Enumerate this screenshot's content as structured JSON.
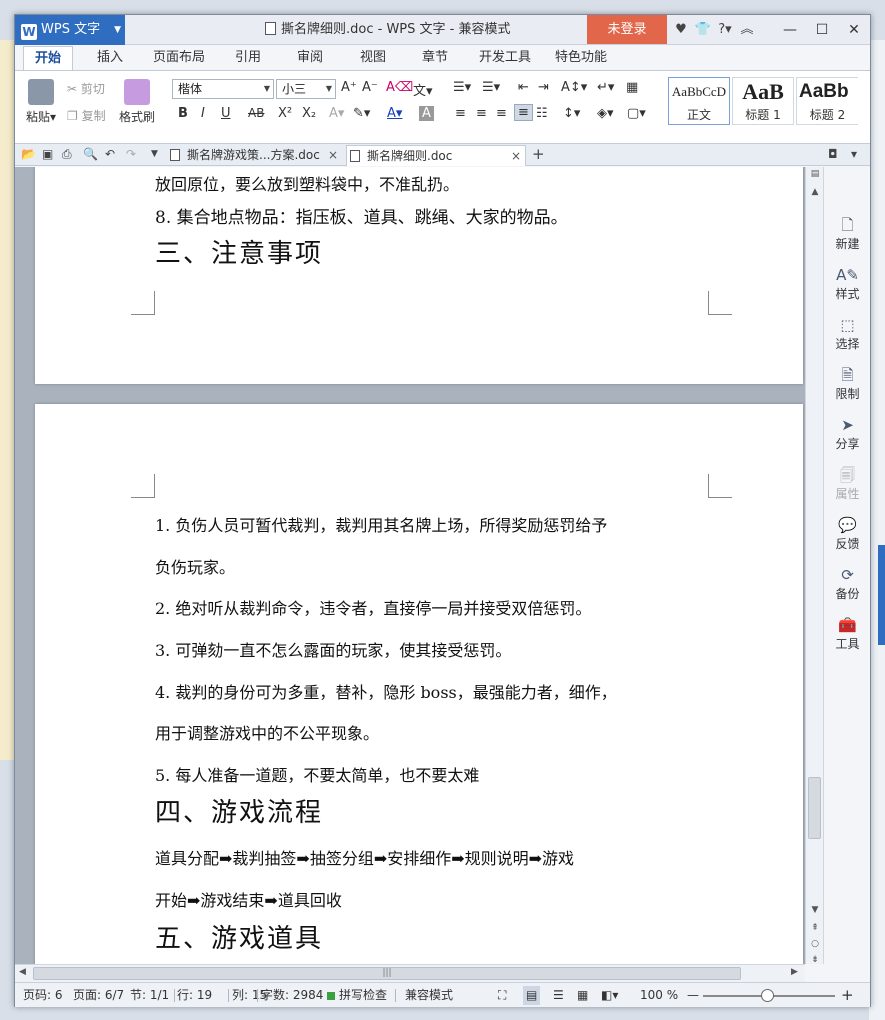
{
  "app": {
    "name": "WPS 文字",
    "window_title": "撕名牌细则.doc - WPS 文字 - 兼容模式",
    "login_label": "未登录",
    "title_icons": [
      "gift-icon",
      "shirt-icon",
      "help-icon",
      "collapse-icon"
    ],
    "window_controls": [
      "minimize",
      "maximize",
      "close"
    ]
  },
  "menu": {
    "tabs": [
      "开始",
      "插入",
      "页面布局",
      "引用",
      "审阅",
      "视图",
      "章节",
      "开发工具",
      "特色功能"
    ],
    "active": "开始"
  },
  "ribbon": {
    "paste": "粘贴",
    "cut": "剪切",
    "copy": "复制",
    "format_painter": "格式刷",
    "font_name": "楷体",
    "font_size": "小三",
    "bold": "B",
    "italic": "I",
    "underline": "U",
    "strike": "AB",
    "superscript": "X²",
    "subscript": "X₂",
    "styles": [
      {
        "preview": "AaBbCcD",
        "name": "正文"
      },
      {
        "preview": "AaB",
        "name": "标题 1"
      },
      {
        "preview": "AaBb",
        "name": "标题 2"
      }
    ]
  },
  "doc_tabs": [
    {
      "label": "撕名牌游戏策...方案.doc",
      "active": false
    },
    {
      "label": "撕名牌细则.doc",
      "active": true
    }
  ],
  "document": {
    "page1": {
      "cut_line": "放回原位，要么放到塑料袋中，不准乱扔。",
      "item8": "8. 集合地点物品：指压板、道具、跳绳、大家的物品。",
      "heading3": "三、注意事项"
    },
    "page2": {
      "p1a": "1. 负伤人员可暂代裁判，裁判用其名牌上场，所得奖励惩罚给予",
      "p1b": "负伤玩家。",
      "p2": "2. 绝对听从裁判命令，违令者，直接停一局并接受双倍惩罚。",
      "p3": "3. 可弹劾一直不怎么露面的玩家，使其接受惩罚。",
      "p4a": "4. 裁判的身份可为多重，替补，隐形 boss，最强能力者，细作，",
      "p4b": "用于调整游戏中的不公平现象。",
      "p5": "5. 每人准备一道题，不要太简单，也不要太难",
      "heading4": "四、游戏流程",
      "flow_a": "道具分配➡裁判抽签➡抽签分组➡安排细作➡规则说明➡游戏",
      "flow_b": "开始➡游戏结束➡道具回收",
      "heading5": "五、游戏道具"
    }
  },
  "side_panel": [
    "新建",
    "样式",
    "选择",
    "限制",
    "分享",
    "属性",
    "反馈",
    "备份",
    "工具"
  ],
  "status": {
    "page_code": "页码: 6",
    "page": "页面: 6/7",
    "section": "节: 1/1",
    "row": "行: 19",
    "col": "列: 15",
    "words": "字数: 2984",
    "spell": "拼写检查",
    "mode": "兼容模式",
    "zoom": "100 %",
    "zoom_value": 100
  },
  "colors": {
    "app_blue": "#2f6dc0",
    "login_red": "#e2664a"
  }
}
